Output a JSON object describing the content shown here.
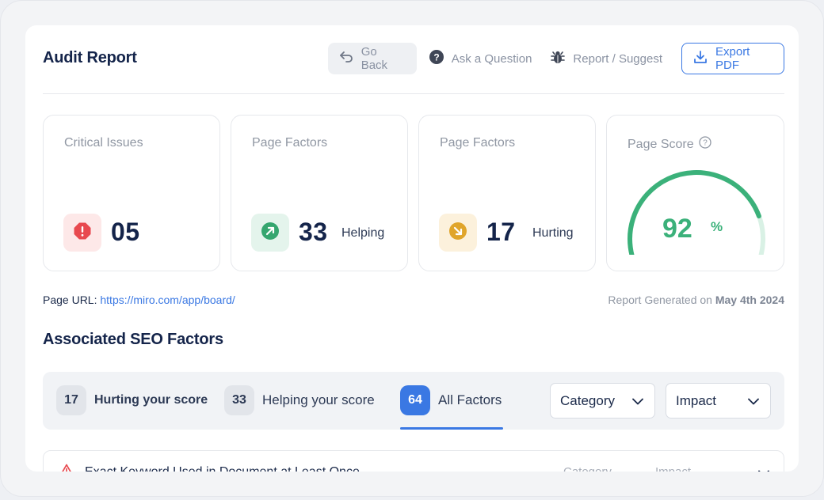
{
  "header": {
    "title": "Audit Report",
    "go_back": "Go Back",
    "ask_question": "Ask a Question",
    "report_suggest": "Report / Suggest",
    "export_pdf": "Export PDF"
  },
  "stats": {
    "critical": {
      "label": "Critical Issues",
      "value": "05",
      "icon": "alert-octagon-icon",
      "color": "#e8494f"
    },
    "helping": {
      "label": "Page Factors",
      "value": "33",
      "sub": "Helping",
      "icon": "arrow-up-right-icon",
      "color": "#35a66f"
    },
    "hurting": {
      "label": "Page Factors",
      "value": "17",
      "sub": "Hurting",
      "icon": "arrow-down-right-icon",
      "color": "#e0a52b"
    },
    "score": {
      "label": "Page Score",
      "value": "92",
      "unit": "%",
      "fraction": 0.92,
      "color": "#3bb17a"
    }
  },
  "page_url": {
    "label": "Page URL:",
    "url": "https://miro.com/app/board/"
  },
  "generated": {
    "prefix": "Report Generated on",
    "date": "May 4th 2024"
  },
  "section_title": "Associated SEO Factors",
  "filters": {
    "tabs": [
      {
        "count": "17",
        "label": "Hurting your score",
        "active": false
      },
      {
        "count": "33",
        "label": "Helping your score",
        "active": false
      },
      {
        "count": "64",
        "label": "All Factors",
        "active": true
      }
    ],
    "category": "Category",
    "impact": "Impact"
  },
  "rows": [
    {
      "title": "Exact Keyword Used in Document at Least Once",
      "category": "Category",
      "impact": "Impact"
    }
  ],
  "colors": {
    "accent": "#3a78e3",
    "navy": "#14244a"
  }
}
